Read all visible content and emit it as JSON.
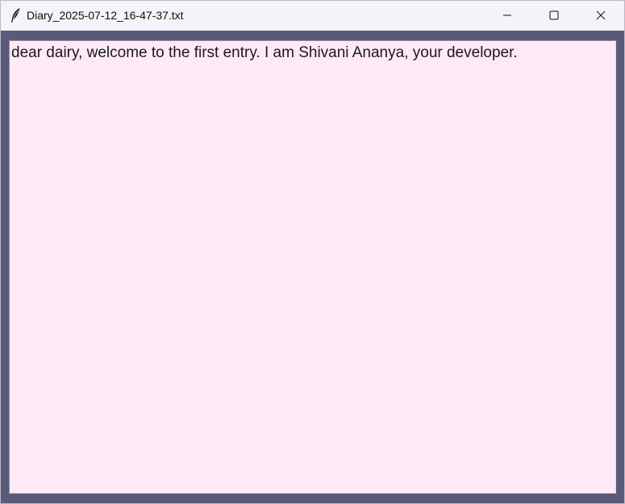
{
  "window": {
    "title": "Diary_2025-07-12_16-47-37.txt",
    "app_icon": "feather-quill-icon"
  },
  "controls": {
    "minimize": "minimize-icon",
    "maximize": "maximize-icon",
    "close": "close-icon"
  },
  "editor": {
    "content": "dear dairy, welcome to the first entry. I am Shivani Ananya, your developer."
  },
  "colors": {
    "titlebar_bg": "#f3f3f8",
    "frame_bg": "#5a5a7a",
    "editor_bg": "#ffeaf5",
    "text": "#1a1a1a"
  }
}
